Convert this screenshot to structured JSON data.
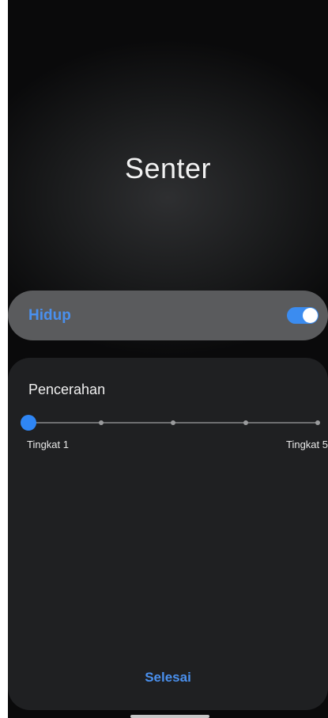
{
  "app": {
    "title": "Senter"
  },
  "toggle": {
    "label": "Hidup",
    "state": "on",
    "accent_color": "#3b8cf0"
  },
  "brightness": {
    "title": "Pencerahan",
    "min_label": "Tingkat 1",
    "max_label": "Tingkat 5",
    "levels": 5,
    "current_level": 1
  },
  "actions": {
    "done_label": "Selesai"
  },
  "colors": {
    "accent": "#4a90ee",
    "panel_bg": "#1f2022",
    "toggle_row_bg": "#5a5b5d"
  }
}
